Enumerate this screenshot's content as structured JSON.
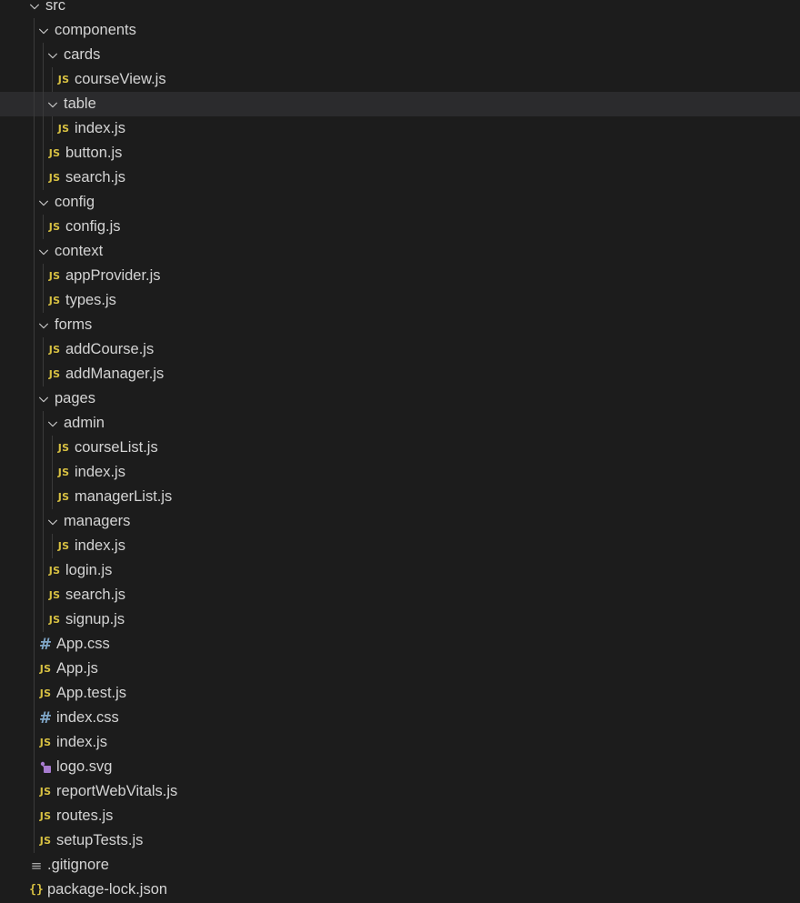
{
  "explorer": {
    "rows": [
      {
        "label": "src",
        "type": "folder",
        "depth": 0,
        "icon": "chevron-down-icon"
      },
      {
        "label": "components",
        "type": "folder",
        "depth": 1,
        "icon": "chevron-down-icon"
      },
      {
        "label": "cards",
        "type": "folder",
        "depth": 2,
        "icon": "chevron-down-icon"
      },
      {
        "label": "courseView.js",
        "type": "js",
        "depth": 3,
        "icon": "js-file-icon",
        "icon_text": "JS"
      },
      {
        "label": "table",
        "type": "folder",
        "depth": 2,
        "icon": "chevron-down-icon",
        "selected": true
      },
      {
        "label": "index.js",
        "type": "js",
        "depth": 3,
        "icon": "js-file-icon",
        "icon_text": "JS"
      },
      {
        "label": "button.js",
        "type": "js",
        "depth": 2,
        "icon": "js-file-icon",
        "icon_text": "JS"
      },
      {
        "label": "search.js",
        "type": "js",
        "depth": 2,
        "icon": "js-file-icon",
        "icon_text": "JS"
      },
      {
        "label": "config",
        "type": "folder",
        "depth": 1,
        "icon": "chevron-down-icon"
      },
      {
        "label": "config.js",
        "type": "js",
        "depth": 2,
        "icon": "js-file-icon",
        "icon_text": "JS"
      },
      {
        "label": "context",
        "type": "folder",
        "depth": 1,
        "icon": "chevron-down-icon"
      },
      {
        "label": "appProvider.js",
        "type": "js",
        "depth": 2,
        "icon": "js-file-icon",
        "icon_text": "JS"
      },
      {
        "label": "types.js",
        "type": "js",
        "depth": 2,
        "icon": "js-file-icon",
        "icon_text": "JS"
      },
      {
        "label": "forms",
        "type": "folder",
        "depth": 1,
        "icon": "chevron-down-icon"
      },
      {
        "label": "addCourse.js",
        "type": "js",
        "depth": 2,
        "icon": "js-file-icon",
        "icon_text": "JS"
      },
      {
        "label": "addManager.js",
        "type": "js",
        "depth": 2,
        "icon": "js-file-icon",
        "icon_text": "JS"
      },
      {
        "label": "pages",
        "type": "folder",
        "depth": 1,
        "icon": "chevron-down-icon"
      },
      {
        "label": "admin",
        "type": "folder",
        "depth": 2,
        "icon": "chevron-down-icon"
      },
      {
        "label": "courseList.js",
        "type": "js",
        "depth": 3,
        "icon": "js-file-icon",
        "icon_text": "JS"
      },
      {
        "label": "index.js",
        "type": "js",
        "depth": 3,
        "icon": "js-file-icon",
        "icon_text": "JS"
      },
      {
        "label": "managerList.js",
        "type": "js",
        "depth": 3,
        "icon": "js-file-icon",
        "icon_text": "JS"
      },
      {
        "label": "managers",
        "type": "folder",
        "depth": 2,
        "icon": "chevron-down-icon"
      },
      {
        "label": "index.js",
        "type": "js",
        "depth": 3,
        "icon": "js-file-icon",
        "icon_text": "JS"
      },
      {
        "label": "login.js",
        "type": "js",
        "depth": 2,
        "icon": "js-file-icon",
        "icon_text": "JS"
      },
      {
        "label": "search.js",
        "type": "js",
        "depth": 2,
        "icon": "js-file-icon",
        "icon_text": "JS"
      },
      {
        "label": "signup.js",
        "type": "js",
        "depth": 2,
        "icon": "js-file-icon",
        "icon_text": "JS"
      },
      {
        "label": "App.css",
        "type": "css",
        "depth": 1,
        "icon": "css-file-icon",
        "icon_text": "#"
      },
      {
        "label": "App.js",
        "type": "js",
        "depth": 1,
        "icon": "js-file-icon",
        "icon_text": "JS"
      },
      {
        "label": "App.test.js",
        "type": "js",
        "depth": 1,
        "icon": "js-file-icon",
        "icon_text": "JS"
      },
      {
        "label": "index.css",
        "type": "css",
        "depth": 1,
        "icon": "css-file-icon",
        "icon_text": "#"
      },
      {
        "label": "index.js",
        "type": "js",
        "depth": 1,
        "icon": "js-file-icon",
        "icon_text": "JS"
      },
      {
        "label": "logo.svg",
        "type": "svg",
        "depth": 1,
        "icon": "svg-file-icon"
      },
      {
        "label": "reportWebVitals.js",
        "type": "js",
        "depth": 1,
        "icon": "js-file-icon",
        "icon_text": "JS"
      },
      {
        "label": "routes.js",
        "type": "js",
        "depth": 1,
        "icon": "js-file-icon",
        "icon_text": "JS"
      },
      {
        "label": "setupTests.js",
        "type": "js",
        "depth": 1,
        "icon": "js-file-icon",
        "icon_text": "JS"
      },
      {
        "label": ".gitignore",
        "type": "text",
        "depth": 0,
        "icon": "lines-file-icon",
        "icon_text": "≡"
      },
      {
        "label": "package-lock.json",
        "type": "json",
        "depth": 0,
        "icon": "json-file-icon",
        "icon_text": "{}"
      }
    ]
  },
  "colors": {
    "background": "#1c1c1c",
    "selected_row": "#2b2b2d",
    "indent_guide": "#3a3a3a",
    "text": "#d4d4d4",
    "js_icon": "#d8c142",
    "css_icon": "#7fa6c7",
    "svg_icon": "#a77bcf"
  }
}
